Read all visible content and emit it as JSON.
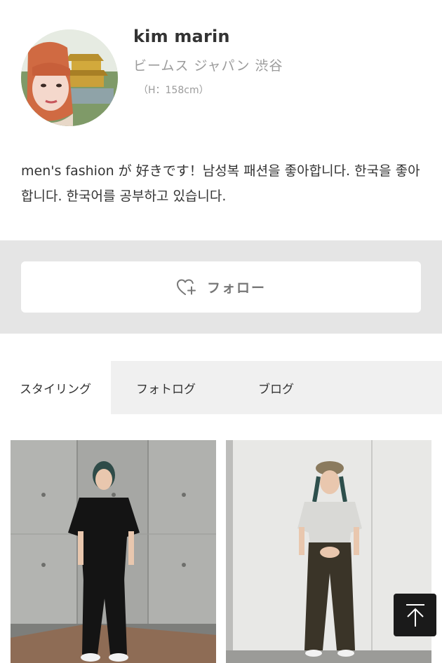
{
  "profile": {
    "name": "kim marin",
    "shop": "ビームス ジャパン 渋谷",
    "height": "（H：158cm）",
    "bio": "men's fashion が 好きです！남성복 패션을 좋아합니다. 한국을 좋아합니다. 한국어를 공부하고 있습니다."
  },
  "follow": {
    "label": "フォロー",
    "icon": "heart-plus-icon"
  },
  "tabs": [
    {
      "label": "スタイリング",
      "active": true
    },
    {
      "label": "フォトログ",
      "active": false
    },
    {
      "label": "ブログ",
      "active": false
    }
  ],
  "photos": [
    {
      "alt": "styling-photo-black-outfit"
    },
    {
      "alt": "styling-photo-grey-shirt-brown-trousers"
    }
  ],
  "back_to_top": {
    "icon": "arrow-up-to-top-icon"
  },
  "colors": {
    "text": "#333333",
    "muted": "#9b9b9b",
    "band": "#e5e5e5",
    "tab_bg": "#f0f0f0",
    "top_button": "#1a1a1a"
  }
}
